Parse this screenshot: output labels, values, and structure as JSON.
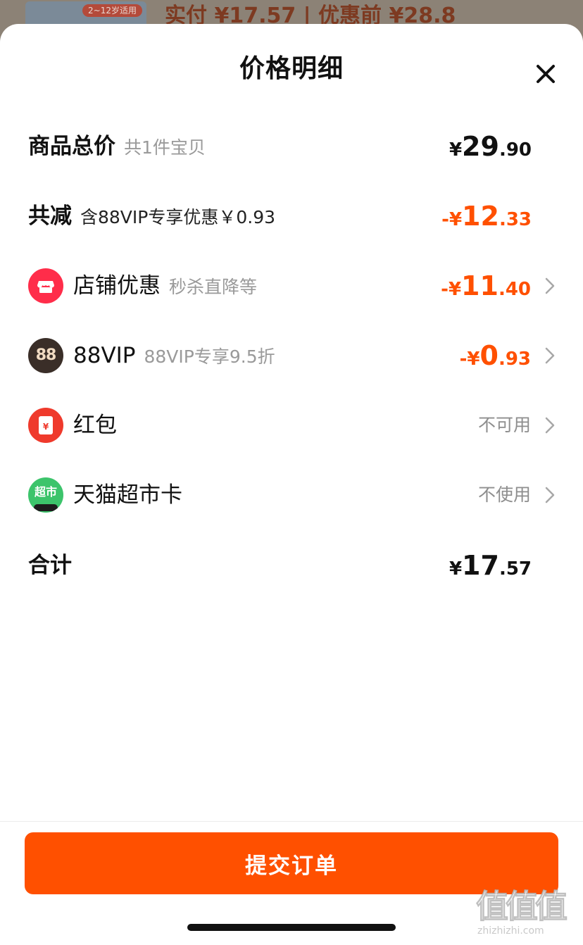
{
  "background": {
    "tag": "2~12岁适用",
    "price_text": "实付 ¥17.57 | 优惠前 ¥28.8"
  },
  "sheet": {
    "title": "价格明细"
  },
  "rows": {
    "total": {
      "label": "商品总价",
      "sub": "共1件宝贝",
      "currency": "¥",
      "int": "29",
      "dec": ".90"
    },
    "reduce": {
      "label": "共减",
      "sub": "含88VIP专享优惠￥0.93",
      "currency": "-¥",
      "int": "12",
      "dec": ".33"
    },
    "shop": {
      "label": "店铺优惠",
      "sub": "秒杀直降等",
      "currency": "-¥",
      "int": "11",
      "dec": ".40"
    },
    "vip": {
      "label": "88VIP",
      "sub": "88VIP专享9.5折",
      "currency": "-¥",
      "int": "0",
      "dec": ".93",
      "icon_text": "88"
    },
    "redpacket": {
      "label": "红包",
      "status": "不可用",
      "icon_text": "¥"
    },
    "tmall_card": {
      "label": "天猫超市卡",
      "status": "不使用",
      "icon_text": "超市"
    },
    "sum": {
      "label": "合计",
      "currency": "¥",
      "int": "17",
      "dec": ".57"
    }
  },
  "actions": {
    "submit_label": "提交订单"
  },
  "watermark": {
    "logo": "值值值",
    "url": "zhizhizhi.com"
  },
  "colors": {
    "accent": "#ff5000",
    "muted": "#9a9a9a",
    "shop_icon": "#ff2d4a",
    "vip_icon": "#3a2e28",
    "redpacket_icon": "#ef3a2c",
    "tmall_card_icon": "#3cc46b"
  },
  "icons": {
    "close": "close-icon",
    "shop": "store-icon",
    "vip": "88vip-icon",
    "redpacket": "red-packet-icon",
    "tmall_card": "supermarket-card-icon",
    "chevron": "chevron-right-icon"
  }
}
